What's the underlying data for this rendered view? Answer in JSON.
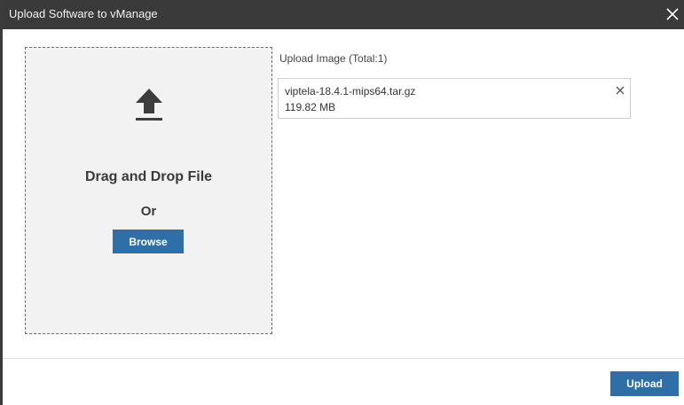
{
  "dialog": {
    "title": "Upload Software to vManage",
    "close_icon": "close-icon"
  },
  "dropzone": {
    "icon": "upload-arrow-icon",
    "drag_text": "Drag and Drop File",
    "or_text": "Or",
    "browse_label": "Browse"
  },
  "upload_list": {
    "label": "Upload Image (Total:1)",
    "files": [
      {
        "name": "viptela-18.4.1-mips64.tar.gz",
        "size": "119.82 MB",
        "remove_icon": "close-icon"
      }
    ]
  },
  "footer": {
    "upload_label": "Upload"
  },
  "colors": {
    "titlebar_bg": "#3a3a3a",
    "primary_button": "#2d6fa6",
    "dropzone_bg": "#f2f2f2"
  }
}
